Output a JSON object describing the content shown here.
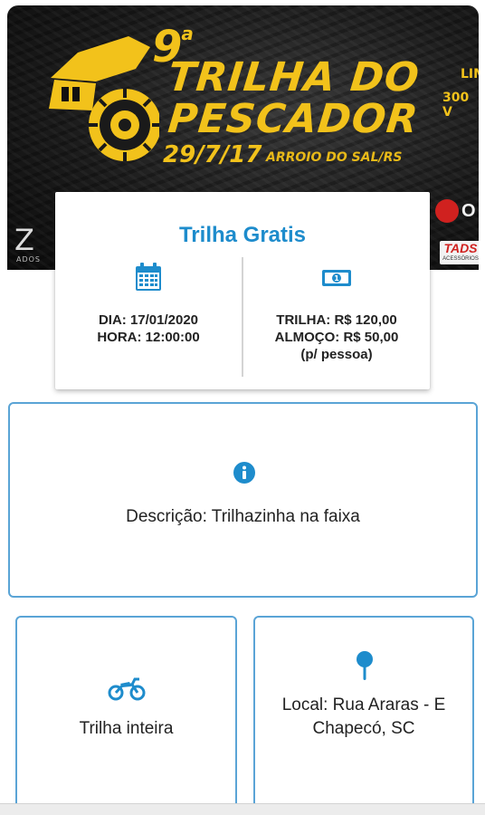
{
  "banner": {
    "edition": "9",
    "edition_sup": "a",
    "title_line1": "TRILHA DO",
    "title_line2": "PESCADOR",
    "date": "29/7/17",
    "place": "ARROIO DO SAL/RS",
    "side_text1": "LIM",
    "side_text2": "300 V",
    "sponsor_left": "Z",
    "sponsor_left_small": "ADOS",
    "sponsor_right": "O",
    "sponsor_tads": "TADS",
    "sponsor_tads_sub": "ACESSÓRIOS",
    "accent_color": "#f2c21b"
  },
  "event": {
    "title": "Trilha Gratis",
    "title_color": "#1e8ccc",
    "date_icon": "calendar-icon",
    "date_line": "DIA: 17/01/2020",
    "time_line": "HORA: 12:00:00",
    "price_icon": "money-icon",
    "trail_price": "TRILHA: R$ 120,00",
    "lunch_price": "ALMOÇO: R$ 50,00",
    "per_person": "(p/ pessoa)"
  },
  "description": {
    "icon": "info-icon",
    "text": "Descrição: Trilhazinha na faixa"
  },
  "trail_type": {
    "icon": "motorcycle-icon",
    "text": "Trilha inteira"
  },
  "location": {
    "icon": "map-pin-icon",
    "line1": "Local: Rua Araras - E",
    "line2": "Chapecó, SC"
  },
  "colors": {
    "icon_blue": "#1e8ccc",
    "card_border": "#5aa4d6"
  }
}
